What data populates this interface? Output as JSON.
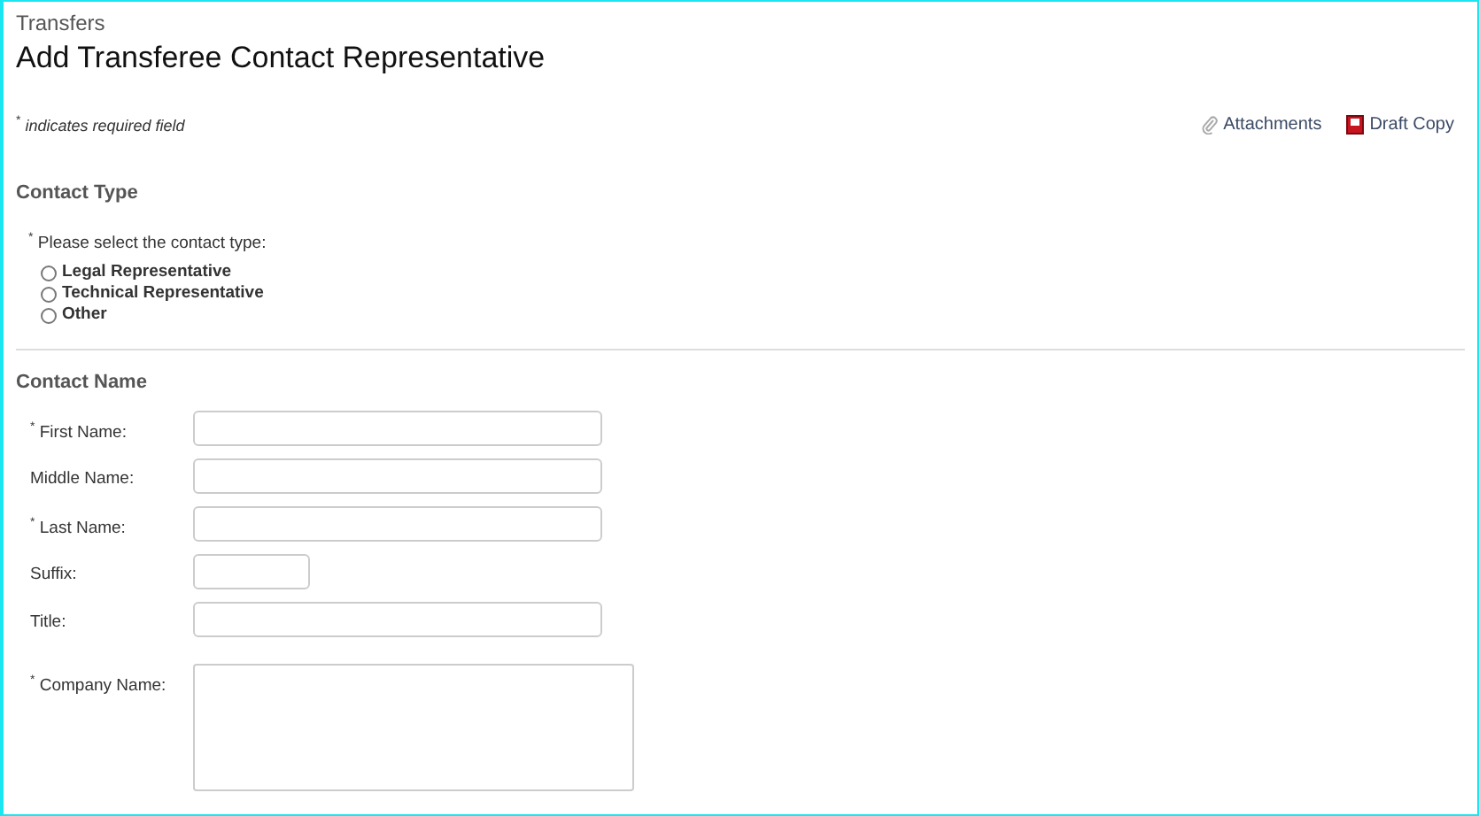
{
  "breadcrumb": "Transfers",
  "title": "Add Transferee Contact Representative",
  "required_note": "$^{*}$ *indicates required field*",
  "actions": [
    {
      "kind": "attachments",
      "label": "Attachments"
    },
    {
      "kind": "pdf",
      "label": "Draft Copy"
    }
  ],
  "contact_type": {
    "heading": "Contact Type",
    "prompt": "$^{*}$ Please select the contact type:",
    "options": [
      {
        "label": "Legal Representative",
        "selected": false
      },
      {
        "label": "Technical Representative",
        "selected": false
      },
      {
        "label": "Other",
        "selected": false
      }
    ]
  },
  "contact_name": {
    "heading": "Contact Name",
    "fields": [
      {
        "label": "$^{*}$ First Name:",
        "kind": "text"
      },
      {
        "label": "Middle Name:",
        "kind": "text"
      },
      {
        "label": "$^{*}$ Last Name:",
        "kind": "text"
      },
      {
        "label": "Suffix:",
        "kind": "short"
      },
      {
        "label": "Title:",
        "kind": "text"
      },
      {
        "label": "$^{*}$ Company Name:",
        "kind": "textarea"
      }
    ]
  }
}
